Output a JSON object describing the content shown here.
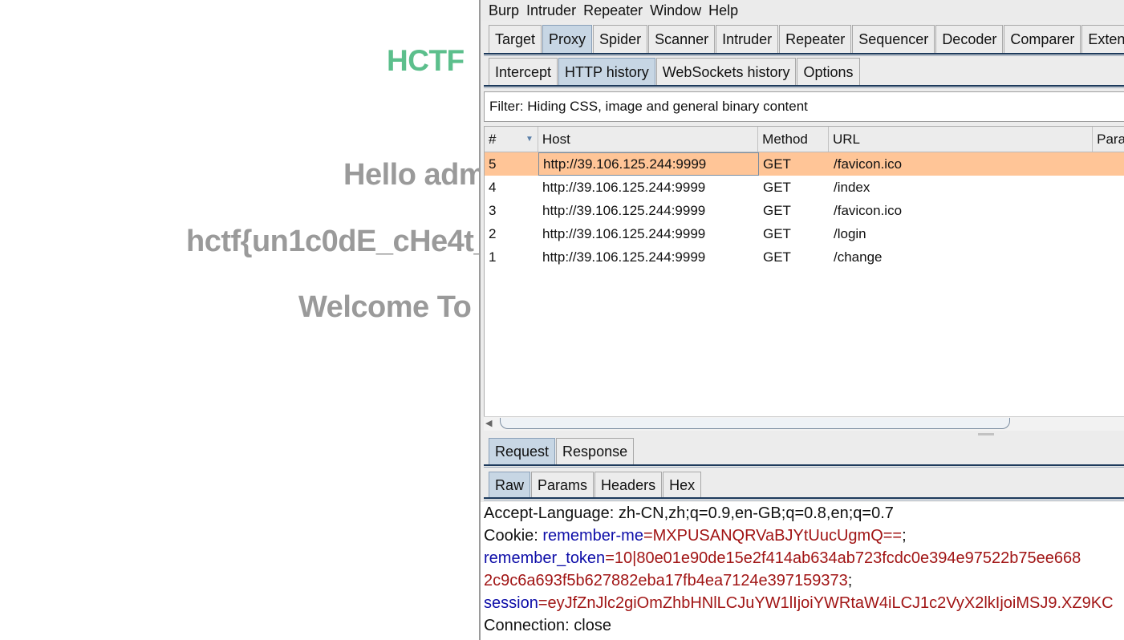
{
  "webpage": {
    "logo": "HCTF",
    "lines": [
      "Hello adm",
      "hctf{un1c0dE_cHe4t_",
      "Welcome To I"
    ]
  },
  "burp": {
    "menu": [
      "Burp",
      "Intruder",
      "Repeater",
      "Window",
      "Help"
    ],
    "main_tabs": [
      "Target",
      "Proxy",
      "Spider",
      "Scanner",
      "Intruder",
      "Repeater",
      "Sequencer",
      "Decoder",
      "Comparer",
      "Extend"
    ],
    "active_main_tab": "Proxy",
    "proxy_tabs": [
      "Intercept",
      "HTTP history",
      "WebSockets history",
      "Options"
    ],
    "active_proxy_tab": "HTTP history",
    "filter_text": "Filter: Hiding CSS, image and general binary content",
    "columns": [
      "#",
      "Host",
      "Method",
      "URL",
      "Para"
    ],
    "rows": [
      {
        "num": "5",
        "host": "http://39.106.125.244:9999",
        "method": "GET",
        "url": "/favicon.ico"
      },
      {
        "num": "4",
        "host": "http://39.106.125.244:9999",
        "method": "GET",
        "url": "/index"
      },
      {
        "num": "3",
        "host": "http://39.106.125.244:9999",
        "method": "GET",
        "url": "/favicon.ico"
      },
      {
        "num": "2",
        "host": "http://39.106.125.244:9999",
        "method": "GET",
        "url": "/login"
      },
      {
        "num": "1",
        "host": "http://39.106.125.244:9999",
        "method": "GET",
        "url": "/change"
      }
    ],
    "selected_row": "5",
    "req_tabs": [
      "Request",
      "Response"
    ],
    "active_req_tab": "Request",
    "view_tabs": [
      "Raw",
      "Params",
      "Headers",
      "Hex"
    ],
    "active_view_tab": "Raw",
    "raw": {
      "accept_language": "Accept-Language: zh-CN,zh;q=0.9,en-GB;q=0.8,en;q=0.7",
      "cookie_label": "Cookie: ",
      "remember_me_key": "remember-me",
      "remember_me_val": "MXPUSANQRVaBJYtUucUgmQ==",
      "remember_token_key": "remember_token",
      "remember_token_val": "10|80e01e90de15e2f414ab634ab723fcdc0e394e97522b75ee668",
      "remember_token_cont": "2c9c6a693f5b627882eba17fb4ea7124e397159373",
      "session_key": "session",
      "session_val": "eyJfZnJlc2giOmZhbHNlLCJuYW1lIjoiYWRtaW4iLCJ1c2VyX2lkIjoiMSJ9.XZ9KC",
      "connection": "Connection: close"
    }
  }
}
